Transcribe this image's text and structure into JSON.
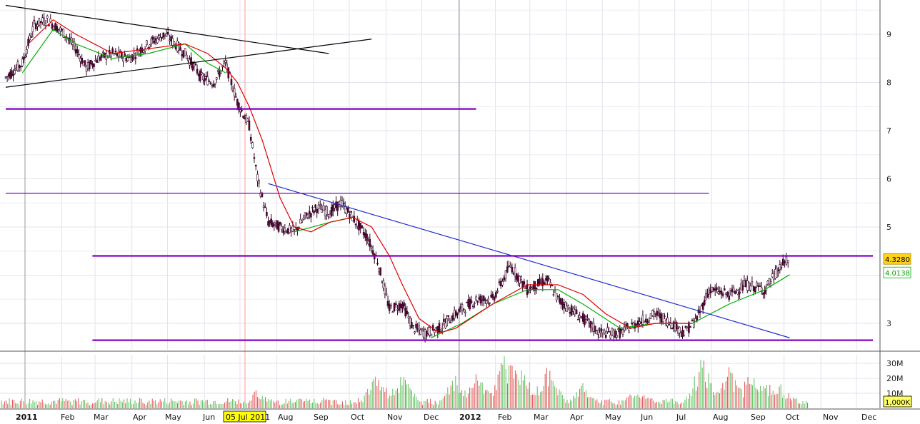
{
  "chart_data": {
    "type": "candlestick",
    "title": "",
    "price_axis": {
      "ticks": [
        3,
        4,
        5,
        6,
        7,
        8,
        9
      ],
      "tick_labels": [
        "3",
        "",
        "5",
        "6",
        "7",
        "8",
        "9"
      ],
      "range": [
        2.6,
        9.6
      ]
    },
    "volume_axis": {
      "tick_labels": [
        "30M",
        "20M",
        "10M"
      ],
      "tick_values": [
        30,
        20,
        10
      ],
      "unit_label": "1,000K"
    },
    "time_axis": {
      "labels": [
        "2011",
        "Feb",
        "Mar",
        "Apr",
        "May",
        "Jun",
        "05 Jul 2011",
        "Aug",
        "Sep",
        "Oct",
        "Nov",
        "Dec",
        "2012",
        "Feb",
        "Mar",
        "Apr",
        "May",
        "Jun",
        "Jul",
        "Aug",
        "Sep",
        "Oct",
        "Nov",
        "Dec"
      ],
      "highlighted_label": "05 Jul 2011",
      "range": [
        "2011-01",
        "2012-12"
      ]
    },
    "last_price_badge": "4.3280",
    "ma_value_badge": "4.0138",
    "series": [
      {
        "kind": "close",
        "points": [
          [
            "2011-01-01",
            8.1
          ],
          [
            "2011-01-15",
            8.4
          ],
          [
            "2011-01-25",
            9.2
          ],
          [
            "2011-02-05",
            9.3
          ],
          [
            "2011-02-20",
            9.0
          ],
          [
            "2011-03-01",
            8.7
          ],
          [
            "2011-03-10",
            8.3
          ],
          [
            "2011-03-20",
            8.5
          ],
          [
            "2011-04-01",
            8.6
          ],
          [
            "2011-04-15",
            8.5
          ],
          [
            "2011-05-01",
            8.8
          ],
          [
            "2011-05-15",
            9.0
          ],
          [
            "2011-06-01",
            8.6
          ],
          [
            "2011-06-15",
            8.1
          ],
          [
            "2011-06-25",
            8.0
          ],
          [
            "2011-07-05",
            8.4
          ],
          [
            "2011-07-15",
            7.6
          ],
          [
            "2011-07-25",
            7.1
          ],
          [
            "2011-08-01",
            6.0
          ],
          [
            "2011-08-10",
            5.1
          ],
          [
            "2011-08-20",
            5.0
          ],
          [
            "2011-09-01",
            4.9
          ],
          [
            "2011-09-10",
            5.2
          ],
          [
            "2011-09-20",
            5.4
          ],
          [
            "2011-10-01",
            5.3
          ],
          [
            "2011-10-10",
            5.5
          ],
          [
            "2011-10-20",
            5.2
          ],
          [
            "2011-11-01",
            4.8
          ],
          [
            "2011-11-10",
            4.3
          ],
          [
            "2011-11-20",
            3.3
          ],
          [
            "2011-12-01",
            3.4
          ],
          [
            "2011-12-10",
            2.9
          ],
          [
            "2011-12-20",
            2.8
          ],
          [
            "2012-01-01",
            2.9
          ],
          [
            "2012-01-15",
            3.2
          ],
          [
            "2012-02-01",
            3.5
          ],
          [
            "2012-02-15",
            3.5
          ],
          [
            "2012-03-01",
            4.2
          ],
          [
            "2012-03-15",
            3.7
          ],
          [
            "2012-04-01",
            3.9
          ],
          [
            "2012-04-10",
            3.5
          ],
          [
            "2012-04-20",
            3.3
          ],
          [
            "2012-05-01",
            3.1
          ],
          [
            "2012-05-15",
            2.8
          ],
          [
            "2012-06-01",
            2.8
          ],
          [
            "2012-06-15",
            3.0
          ],
          [
            "2012-07-01",
            3.2
          ],
          [
            "2012-07-15",
            3.0
          ],
          [
            "2012-07-25",
            2.8
          ],
          [
            "2012-08-05",
            3.1
          ],
          [
            "2012-08-15",
            3.7
          ],
          [
            "2012-09-01",
            3.6
          ],
          [
            "2012-09-15",
            3.8
          ],
          [
            "2012-10-01",
            3.7
          ],
          [
            "2012-10-15",
            4.2
          ],
          [
            "2012-10-22",
            4.33
          ]
        ]
      },
      {
        "kind": "moving_average",
        "color": "#00b000",
        "points": [
          [
            "2011-01-15",
            8.2
          ],
          [
            "2011-02-10",
            9.1
          ],
          [
            "2011-03-01",
            8.8
          ],
          [
            "2011-04-01",
            8.5
          ],
          [
            "2011-05-01",
            8.6
          ],
          [
            "2011-06-01",
            8.8
          ],
          [
            "2011-06-20",
            8.4
          ],
          [
            "2011-07-05",
            8.2
          ]
        ]
      },
      {
        "kind": "moving_average",
        "color": "#00b000",
        "points": [
          [
            "2011-09-01",
            4.9
          ],
          [
            "2011-10-01",
            5.1
          ],
          [
            "2011-10-20",
            5.2
          ]
        ]
      },
      {
        "kind": "moving_average",
        "color": "#00b000",
        "points": [
          [
            "2011-12-25",
            2.7
          ],
          [
            "2012-01-20",
            3.0
          ],
          [
            "2012-02-15",
            3.4
          ],
          [
            "2012-03-15",
            3.7
          ],
          [
            "2012-04-10",
            3.7
          ],
          [
            "2012-05-01",
            3.4
          ],
          [
            "2012-06-01",
            2.9
          ],
          [
            "2012-07-01",
            3.0
          ],
          [
            "2012-08-01",
            3.0
          ],
          [
            "2012-09-01",
            3.4
          ],
          [
            "2012-10-01",
            3.7
          ],
          [
            "2012-10-22",
            4.01
          ]
        ]
      },
      {
        "kind": "moving_average",
        "color": "#e00000",
        "points": [
          [
            "2011-01-20",
            8.8
          ],
          [
            "2011-02-10",
            9.3
          ],
          [
            "2011-03-01",
            9.0
          ],
          [
            "2011-04-01",
            8.6
          ],
          [
            "2011-05-01",
            8.7
          ],
          [
            "2011-06-01",
            8.8
          ],
          [
            "2011-06-20",
            8.6
          ],
          [
            "2011-07-05",
            8.3
          ],
          [
            "2011-07-15",
            8.0
          ],
          [
            "2011-07-25",
            7.5
          ],
          [
            "2011-08-05",
            6.8
          ],
          [
            "2011-08-20",
            5.6
          ],
          [
            "2011-09-01",
            5.0
          ],
          [
            "2011-09-15",
            4.9
          ],
          [
            "2011-10-01",
            5.1
          ],
          [
            "2011-10-20",
            5.2
          ],
          [
            "2011-11-05",
            5.0
          ],
          [
            "2011-11-20",
            4.4
          ],
          [
            "2011-12-01",
            3.8
          ],
          [
            "2011-12-15",
            3.1
          ],
          [
            "2012-01-01",
            2.8
          ],
          [
            "2012-01-15",
            2.9
          ],
          [
            "2012-02-15",
            3.4
          ],
          [
            "2012-03-15",
            3.8
          ],
          [
            "2012-04-10",
            3.8
          ],
          [
            "2012-05-01",
            3.6
          ],
          [
            "2012-05-20",
            3.2
          ],
          [
            "2012-06-10",
            2.9
          ],
          [
            "2012-07-01",
            3.0
          ],
          [
            "2012-08-01",
            3.0
          ]
        ]
      }
    ],
    "trendlines": [
      {
        "color": "#000000",
        "from": [
          "2011-01-01",
          9.6
        ],
        "to": [
          "2011-09-30",
          8.6
        ]
      },
      {
        "color": "#000000",
        "from": [
          "2011-01-01",
          7.9
        ],
        "to": [
          "2011-11-05",
          8.9
        ]
      },
      {
        "color": "#1f2fd0",
        "from": [
          "2011-08-10",
          5.9
        ],
        "to": [
          "2012-10-22",
          2.7
        ]
      }
    ],
    "horizontal_lines": [
      {
        "color": "#8000c0",
        "value": 7.45,
        "from": "2011-01-01",
        "to": "2012-02-01"
      },
      {
        "color": "#8000c0",
        "value": 5.7,
        "from": "2011-01-01",
        "to": "2012-08-15"
      },
      {
        "color": "#8000c0",
        "value": 4.4,
        "from": "2011-03-15",
        "to": "2012-12-31"
      },
      {
        "color": "#8000c0",
        "value": 2.65,
        "from": "2011-03-15",
        "to": "2012-12-31"
      }
    ],
    "volume": {
      "typical_level": 5,
      "peaks": [
        [
          "2011-08-01",
          12
        ],
        [
          "2011-11-10",
          25
        ],
        [
          "2011-12-01",
          22
        ],
        [
          "2012-01-15",
          21
        ],
        [
          "2012-02-01",
          26
        ],
        [
          "2012-02-25",
          33
        ],
        [
          "2012-03-01",
          30
        ],
        [
          "2012-03-10",
          27
        ],
        [
          "2012-04-01",
          28
        ],
        [
          "2012-05-01",
          16
        ],
        [
          "2012-06-15",
          13
        ],
        [
          "2012-08-10",
          33
        ],
        [
          "2012-09-01",
          27
        ],
        [
          "2012-09-20",
          24
        ],
        [
          "2012-10-01",
          19
        ],
        [
          "2012-10-15",
          15
        ]
      ]
    },
    "grid": true
  }
}
